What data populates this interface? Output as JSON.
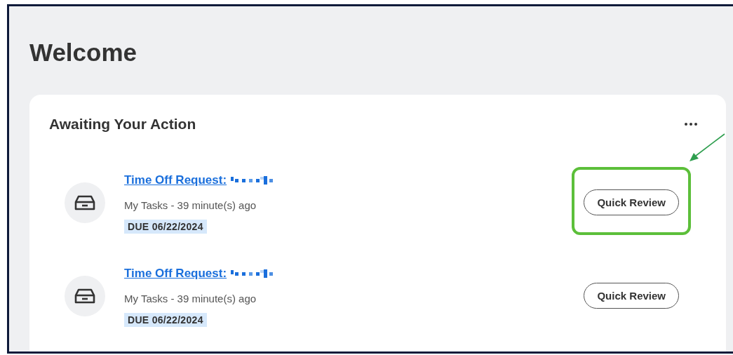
{
  "page": {
    "title": "Welcome"
  },
  "card": {
    "title": "Awaiting Your Action",
    "items": [
      {
        "link": "Time Off Request:",
        "meta": "My Tasks - 39 minute(s) ago",
        "due": "DUE 06/22/2024",
        "button": "Quick Review",
        "highlighted": true
      },
      {
        "link": "Time Off Request:",
        "meta": "My Tasks - 39 minute(s) ago",
        "due": "DUE 06/22/2024",
        "button": "Quick Review",
        "highlighted": false
      }
    ]
  }
}
